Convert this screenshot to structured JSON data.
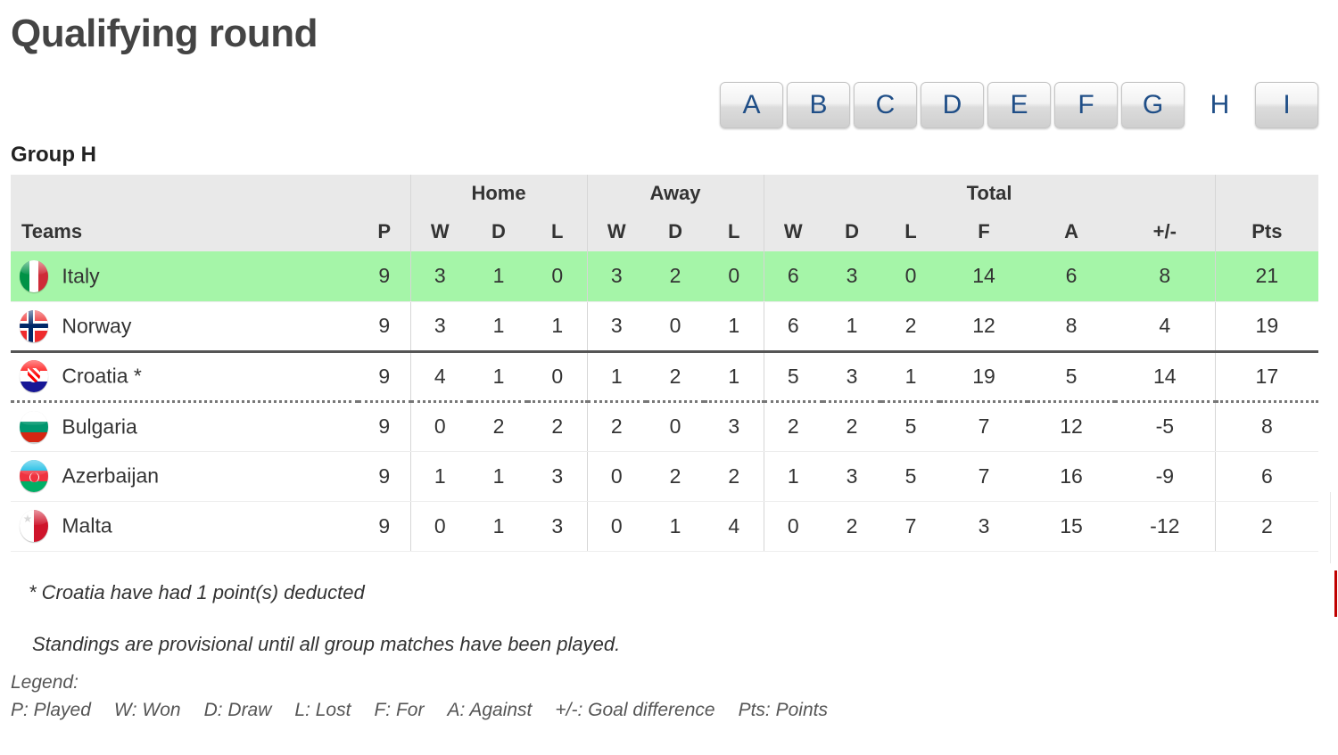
{
  "page_title": "Qualifying round",
  "group_nav": {
    "groups": [
      {
        "label": "A",
        "active": false
      },
      {
        "label": "B",
        "active": false
      },
      {
        "label": "C",
        "active": false
      },
      {
        "label": "D",
        "active": false
      },
      {
        "label": "E",
        "active": false
      },
      {
        "label": "F",
        "active": false
      },
      {
        "label": "G",
        "active": false
      },
      {
        "label": "H",
        "active": true
      },
      {
        "label": "I",
        "active": false
      }
    ]
  },
  "group_heading": "Group H",
  "table": {
    "group_headers": {
      "teams": "",
      "home": "Home",
      "away": "Away",
      "total": "Total",
      "pts": ""
    },
    "columns": {
      "teams": "Teams",
      "p": "P",
      "home_w": "W",
      "home_d": "D",
      "home_l": "L",
      "away_w": "W",
      "away_d": "D",
      "away_l": "L",
      "total_w": "W",
      "total_d": "D",
      "total_l": "L",
      "total_f": "F",
      "total_a": "A",
      "total_gd": "+/-",
      "pts": "Pts"
    },
    "rows": [
      {
        "team": "Italy",
        "flag": "flag-italy",
        "highlight": true,
        "separator": "none",
        "p": "9",
        "home": {
          "w": "3",
          "d": "1",
          "l": "0"
        },
        "away": {
          "w": "3",
          "d": "2",
          "l": "0"
        },
        "total": {
          "w": "6",
          "d": "3",
          "l": "0",
          "f": "14",
          "a": "6",
          "gd": "8"
        },
        "pts": "21"
      },
      {
        "team": "Norway",
        "flag": "flag-norway",
        "highlight": false,
        "separator": "thick",
        "p": "9",
        "home": {
          "w": "3",
          "d": "1",
          "l": "1"
        },
        "away": {
          "w": "3",
          "d": "0",
          "l": "1"
        },
        "total": {
          "w": "6",
          "d": "1",
          "l": "2",
          "f": "12",
          "a": "8",
          "gd": "4"
        },
        "pts": "19"
      },
      {
        "team": "Croatia *",
        "flag": "flag-croatia",
        "highlight": false,
        "separator": "dotted",
        "p": "9",
        "home": {
          "w": "4",
          "d": "1",
          "l": "0"
        },
        "away": {
          "w": "1",
          "d": "2",
          "l": "1"
        },
        "total": {
          "w": "5",
          "d": "3",
          "l": "1",
          "f": "19",
          "a": "5",
          "gd": "14"
        },
        "pts": "17"
      },
      {
        "team": "Bulgaria",
        "flag": "flag-bulgaria",
        "highlight": false,
        "separator": "none",
        "p": "9",
        "home": {
          "w": "0",
          "d": "2",
          "l": "2"
        },
        "away": {
          "w": "2",
          "d": "0",
          "l": "3"
        },
        "total": {
          "w": "2",
          "d": "2",
          "l": "5",
          "f": "7",
          "a": "12",
          "gd": "-5"
        },
        "pts": "8"
      },
      {
        "team": "Azerbaijan",
        "flag": "flag-azerbaijan",
        "highlight": false,
        "separator": "none",
        "p": "9",
        "home": {
          "w": "1",
          "d": "1",
          "l": "3"
        },
        "away": {
          "w": "0",
          "d": "2",
          "l": "2"
        },
        "total": {
          "w": "1",
          "d": "3",
          "l": "5",
          "f": "7",
          "a": "16",
          "gd": "-9"
        },
        "pts": "6"
      },
      {
        "team": "Malta",
        "flag": "flag-malta",
        "highlight": false,
        "separator": "none",
        "p": "9",
        "home": {
          "w": "0",
          "d": "1",
          "l": "3"
        },
        "away": {
          "w": "0",
          "d": "1",
          "l": "4"
        },
        "total": {
          "w": "0",
          "d": "2",
          "l": "7",
          "f": "3",
          "a": "15",
          "gd": "-12"
        },
        "pts": "2"
      }
    ]
  },
  "notes": {
    "deduction": "* Croatia have had 1 point(s) deducted",
    "provisional": "Standings are provisional until all group matches have been played.",
    "legend_title": "Legend:",
    "legend_items": [
      "P: Played",
      "W: Won",
      "D: Draw",
      "L: Lost",
      "F: For",
      "A: Against",
      "+/-: Goal difference",
      "Pts: Points"
    ]
  },
  "colors": {
    "qualified_row": "#a5f5a8",
    "header_bg": "#e9e9e9",
    "button_text": "#1f4e87",
    "title_text": "#444444",
    "edge_marker": "#c00000"
  }
}
